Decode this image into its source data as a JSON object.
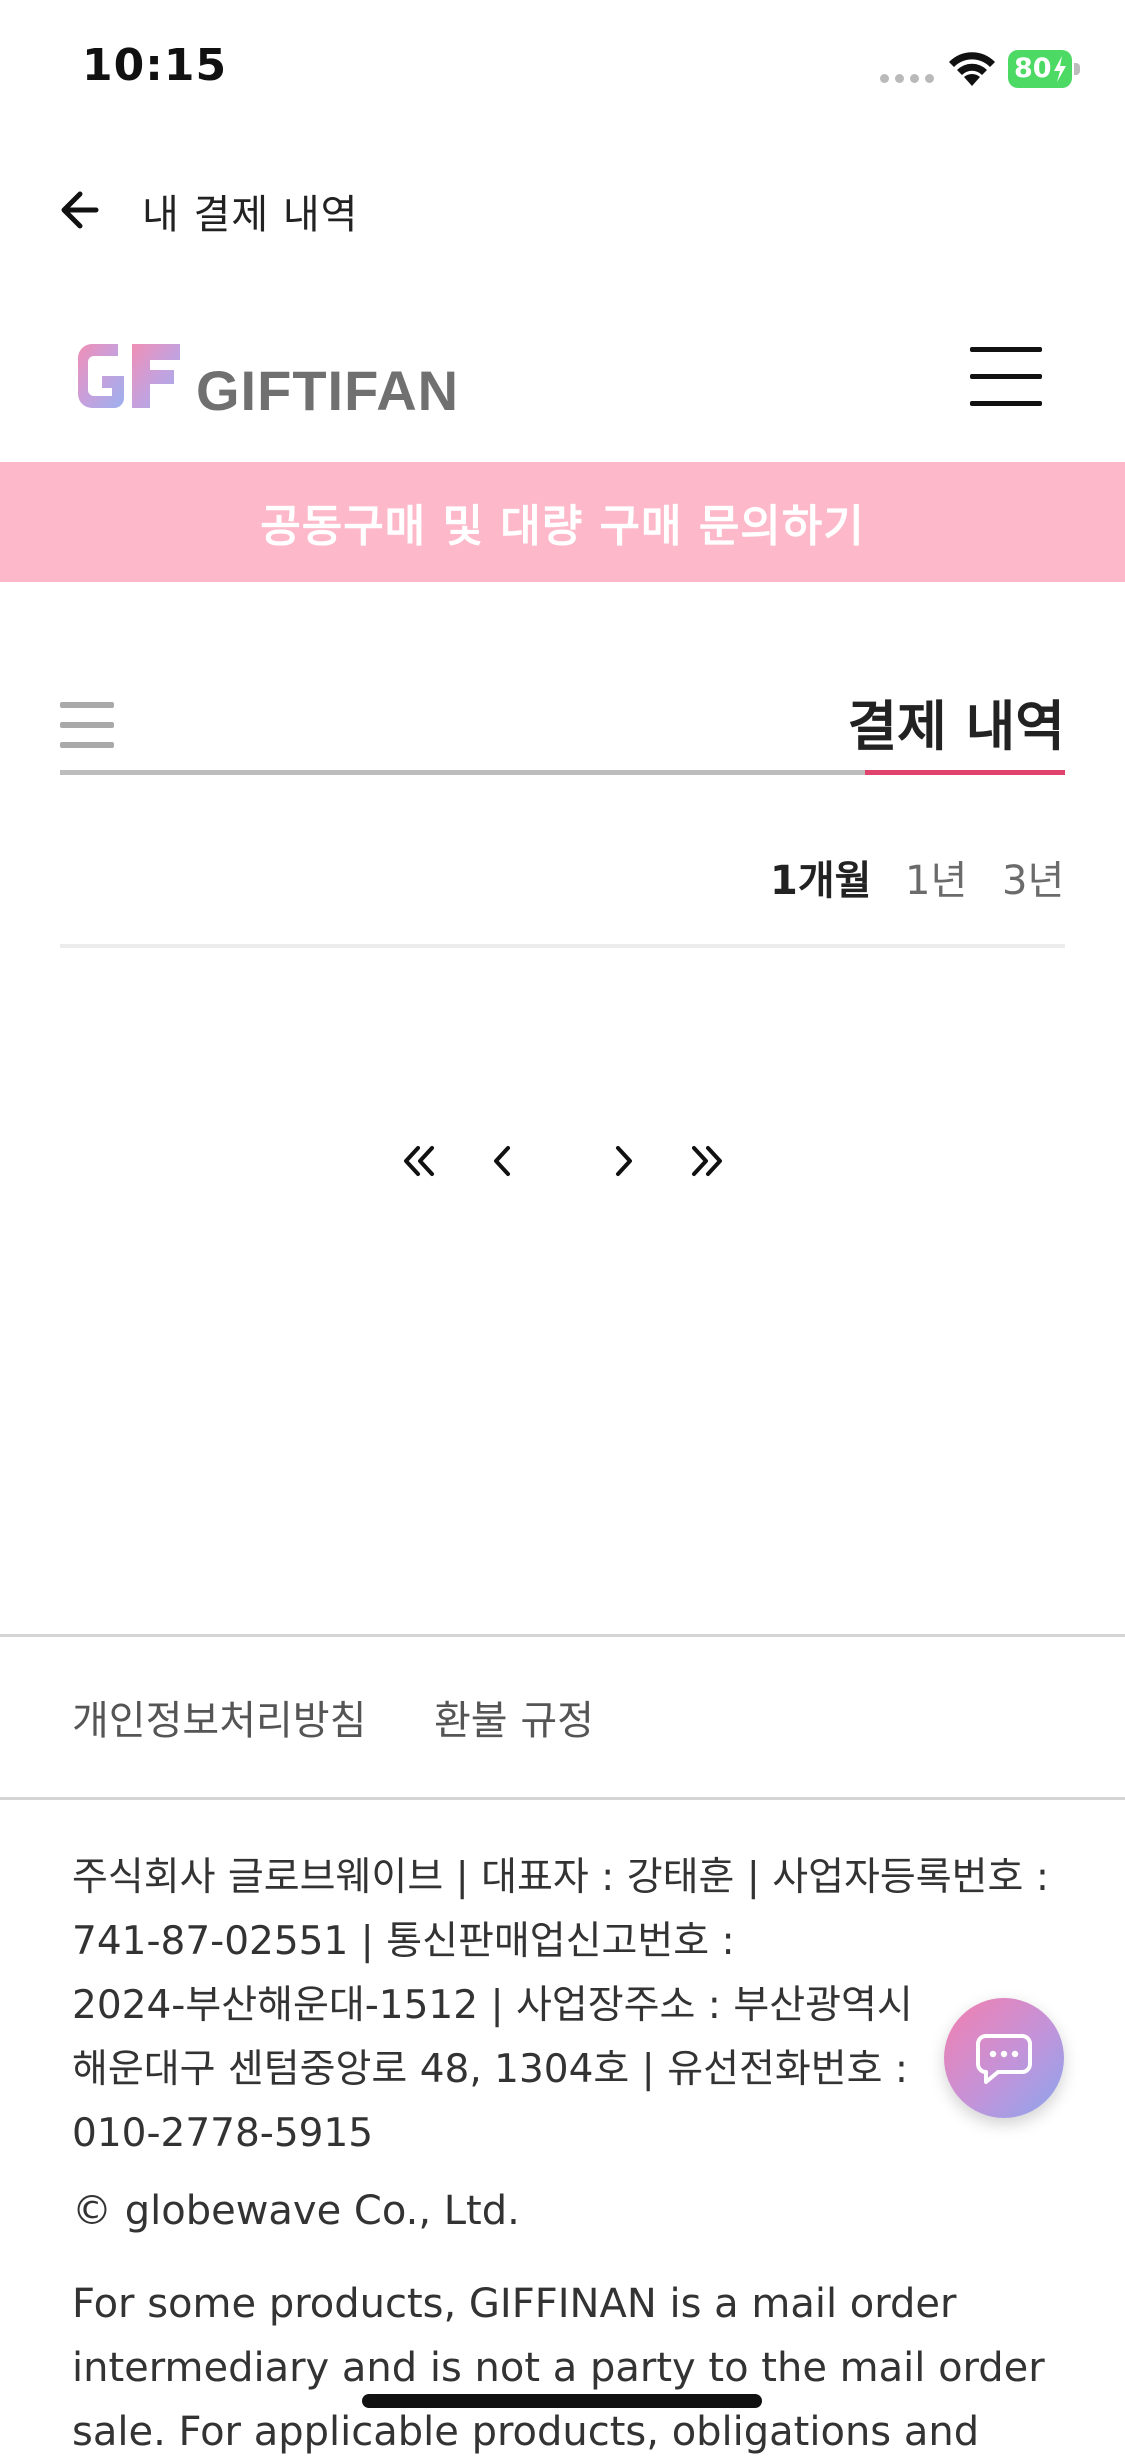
{
  "status_bar": {
    "time": "10:15",
    "battery_level": "80"
  },
  "nav": {
    "title": "내 결제 내역"
  },
  "site_header": {
    "logo_text": "GIFTIFAN"
  },
  "banner": {
    "text": "공동구매 및 대량 구매 문의하기"
  },
  "section": {
    "title": "결제 내역"
  },
  "period_filter": {
    "options": [
      "1개월",
      "1년",
      "3년"
    ],
    "selected": "1개월"
  },
  "footer": {
    "links": [
      "개인정보처리방침",
      "환불 규정"
    ],
    "company_info_lines": [
      "주식회사 글로브웨이브 | 대표자 : 강태훈 | 사업자등록번호 :",
      "741-87-02551 | 통신판매업신고번호 :",
      "2024-부산해운대-1512 | 사업장주소 : 부산광역시",
      "해운대구 센텀중앙로 48, 1304호 | 유선전화번호 :",
      "010-2778-5915"
    ],
    "copyright": "© globewave Co., Ltd.",
    "disclaimer_lines": [
      "For some products, GIFFINAN is a mail order",
      "intermediary and is not a party to the mail order",
      "sale. For applicable products, obligations and"
    ]
  },
  "colors": {
    "banner_bg": "#fdb9ca",
    "accent": "#e0436e",
    "battery": "#4cd964"
  },
  "icons": {
    "back": "arrow-left-icon",
    "menu": "hamburger-icon",
    "list": "list-icon",
    "first_page": "double-chevron-left-icon",
    "prev_page": "chevron-left-icon",
    "next_page": "chevron-right-icon",
    "last_page": "double-chevron-right-icon",
    "chat": "chat-bubble-icon"
  }
}
